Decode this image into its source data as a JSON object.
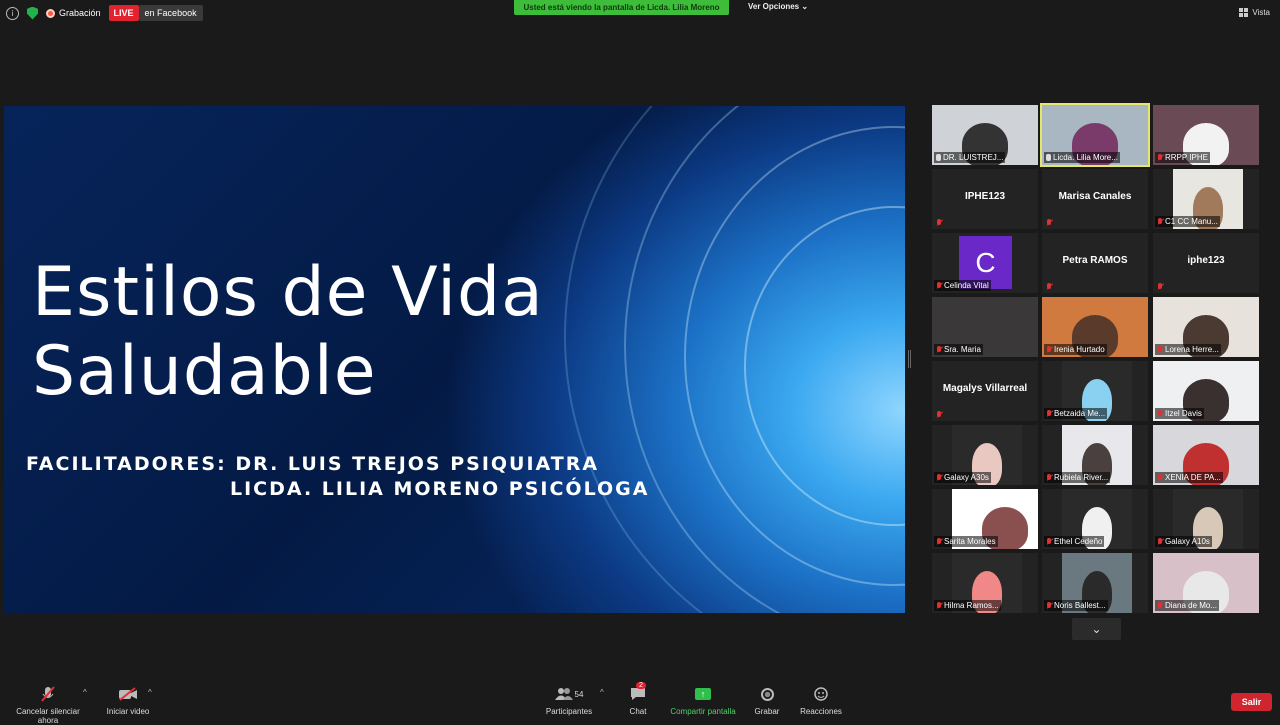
{
  "topbar": {
    "recording_label": "Grabación",
    "live_badge": "LIVE",
    "live_destination": "en Facebook",
    "share_banner": "Usted está viendo la pantalla de Licda. Lilia Moreno",
    "view_options": "Ver Opciones",
    "view_label": "Vista"
  },
  "slide": {
    "title": "Estilos de Vida Saludable",
    "facilitators_line1": "FACILITADORES: DR. LUIS  TREJOS PSIQUIATRA",
    "facilitators_line2": "LICDA. LILIA MORENO PSICÓLOGA"
  },
  "participants": [
    {
      "name": "DR. LUISTREJ...",
      "muted": false,
      "video": true,
      "active": false
    },
    {
      "name": "Licda. Lilia More...",
      "muted": false,
      "video": true,
      "active": true
    },
    {
      "name": "RRPP IPHE",
      "muted": true,
      "video": true,
      "active": false
    },
    {
      "name": "IPHE123",
      "muted": true,
      "video": false,
      "active": false
    },
    {
      "name": "Marisa Canales",
      "muted": true,
      "video": false,
      "active": false
    },
    {
      "name": "C1 CC  Manu...",
      "muted": true,
      "video": true,
      "active": false
    },
    {
      "name": "Celinda Vital",
      "muted": true,
      "video": false,
      "avatar_letter": "C",
      "active": false
    },
    {
      "name": "Petra RAMOS",
      "muted": true,
      "video": false,
      "active": false
    },
    {
      "name": "iphe123",
      "muted": true,
      "video": false,
      "active": false
    },
    {
      "name": "Sra. Maria",
      "muted": true,
      "video": true,
      "active": false
    },
    {
      "name": "Irenia Hurtado",
      "muted": true,
      "video": true,
      "active": false
    },
    {
      "name": "Lorena Herre...",
      "muted": true,
      "video": true,
      "active": false
    },
    {
      "name": "Magalys Villarreal",
      "muted": true,
      "video": false,
      "active": false
    },
    {
      "name": "Betzaida Me...",
      "muted": true,
      "video": true,
      "active": false
    },
    {
      "name": "Itzel Davis",
      "muted": true,
      "video": true,
      "active": false
    },
    {
      "name": "Galaxy A30s",
      "muted": true,
      "video": true,
      "active": false
    },
    {
      "name": "Rubiela River...",
      "muted": true,
      "video": true,
      "active": false
    },
    {
      "name": "XENIA DE PA...",
      "muted": true,
      "video": true,
      "active": false
    },
    {
      "name": "Sarita Morales",
      "muted": true,
      "video": true,
      "active": false
    },
    {
      "name": "Ethel Cedeño",
      "muted": true,
      "video": true,
      "active": false
    },
    {
      "name": "Galaxy A10s",
      "muted": true,
      "video": true,
      "active": false
    },
    {
      "name": "Hilma Ramos...",
      "muted": true,
      "video": true,
      "active": false
    },
    {
      "name": "Noris Ballest...",
      "muted": true,
      "video": true,
      "active": false
    },
    {
      "name": "Diana de Mo...",
      "muted": true,
      "video": true,
      "active": false
    }
  ],
  "bottombar": {
    "mute_label": "Cancelar silenciar ahora",
    "video_label": "Iniciar video",
    "participants_label": "Participantes",
    "participants_count": "54",
    "chat_label": "Chat",
    "chat_badge": "2",
    "share_label": "Compartir pantalla",
    "record_label": "Grabar",
    "reactions_label": "Reacciones",
    "leave_label": "Salir"
  }
}
